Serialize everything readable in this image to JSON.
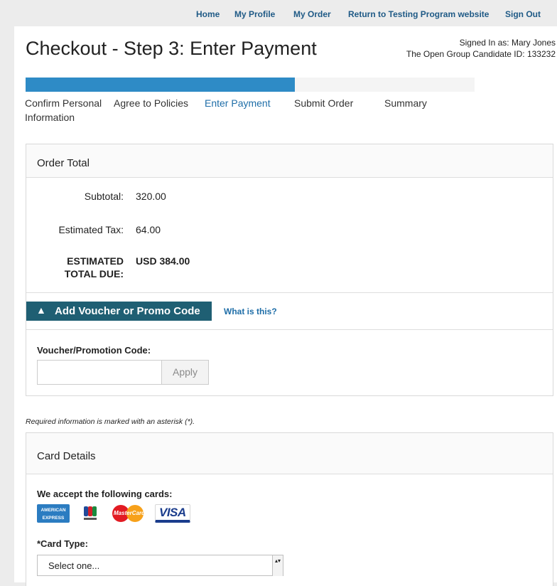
{
  "topnav": {
    "home": "Home",
    "my_profile": "My Profile",
    "my_order": "My Order",
    "return_link": "Return to Testing Program website",
    "sign_out": "Sign Out"
  },
  "header": {
    "title": "Checkout - Step 3: Enter Payment",
    "signed_in": "Signed In as: Mary Jones",
    "candidate_id": "The Open Group Candidate ID: 133232"
  },
  "progress": {
    "value_percent": 60
  },
  "steps": [
    {
      "label": "Confirm Personal Information",
      "active": false
    },
    {
      "label": "Agree to Policies",
      "active": false
    },
    {
      "label": "Enter Payment",
      "active": true
    },
    {
      "label": "Submit Order",
      "active": false
    },
    {
      "label": "Summary",
      "active": false
    }
  ],
  "order_total": {
    "heading": "Order Total",
    "subtotal_label": "Subtotal:",
    "subtotal_value": "320.00",
    "tax_label": "Estimated Tax:",
    "tax_value": "64.00",
    "total_label": "ESTIMATED TOTAL DUE:",
    "total_value": "USD 384.00"
  },
  "voucher": {
    "toggle_label": "Add Voucher or Promo Code",
    "what_is_this": "What is this?",
    "field_label": "Voucher/Promotion Code:",
    "input_value": "",
    "apply_label": "Apply"
  },
  "required_note": "Required information is marked with an asterisk (*).",
  "card_details": {
    "heading": "Card Details",
    "accept_label": "We accept the following cards:",
    "cards": {
      "amex_line1": "AMERICAN",
      "amex_line2": "EXPRESS",
      "mastercard": "MasterCard",
      "visa": "VISA"
    },
    "card_type_label": "*Card Type:",
    "card_type_selected": "Select one..."
  },
  "colors": {
    "link": "#1f5a86",
    "progress_fill": "#2e8bc6",
    "voucher_toggle_bg": "#1f5f73"
  }
}
